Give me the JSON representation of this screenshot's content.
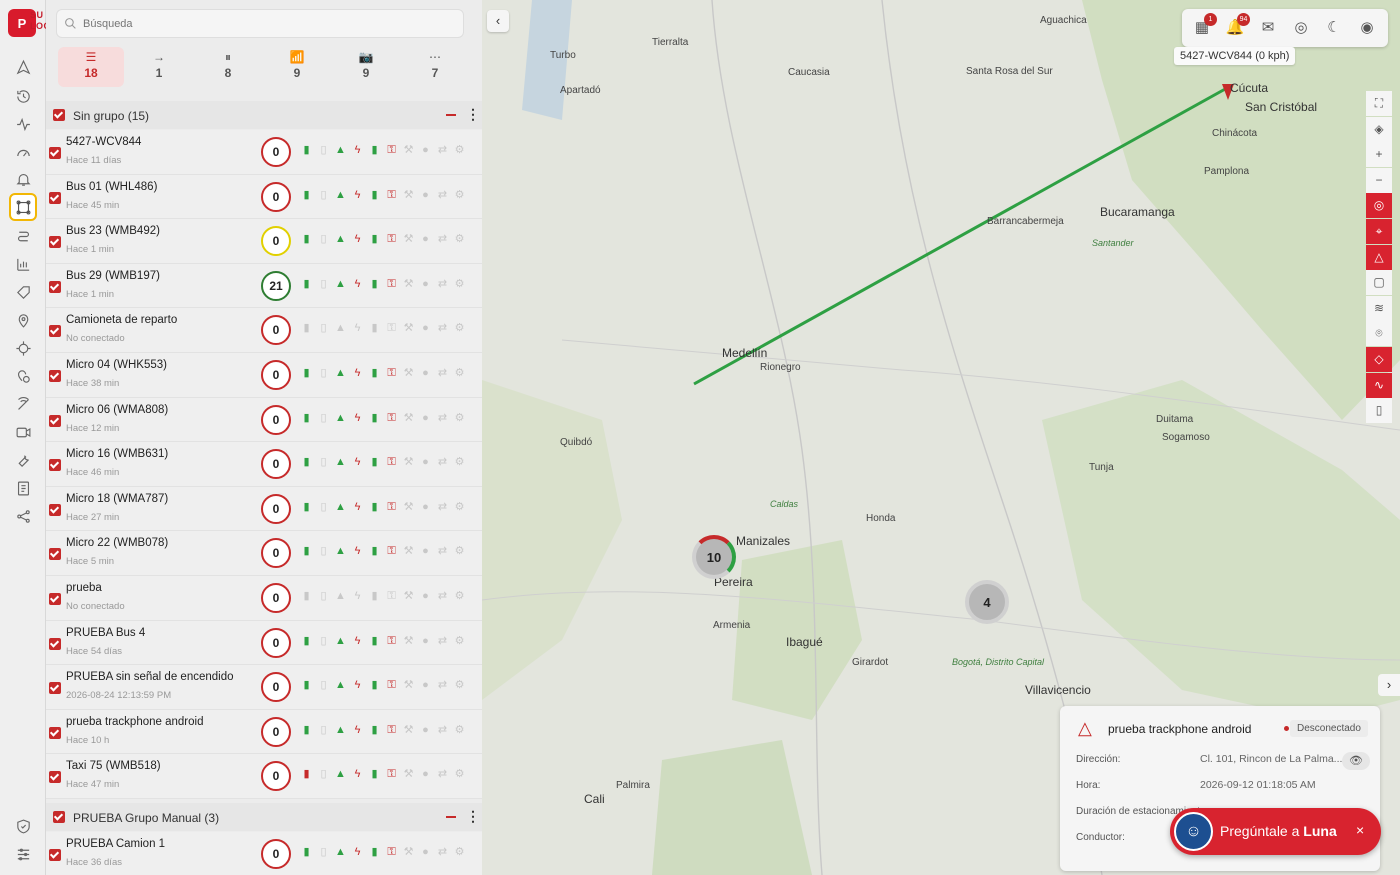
{
  "app": {
    "logo_letter": "P",
    "logo_sub": "SU\nLOGO"
  },
  "search": {
    "placeholder": "Búsqueda"
  },
  "filters": [
    {
      "icon": "list-icon",
      "glyph": "☰",
      "count": "18"
    },
    {
      "icon": "arrow-right-icon",
      "glyph": "→",
      "count": "1"
    },
    {
      "icon": "pause-icon",
      "glyph": "⏸",
      "count": "8"
    },
    {
      "icon": "no-signal-icon",
      "glyph": "📶",
      "count": "9"
    },
    {
      "icon": "camera-icon",
      "glyph": "📷",
      "count": "9"
    },
    {
      "icon": "more-icon",
      "glyph": "⋯",
      "count": "7"
    }
  ],
  "groups": [
    {
      "title": "Sin grupo (15)"
    },
    {
      "title": "PRUEBA Grupo Manual (3)"
    }
  ],
  "vehicles": [
    {
      "name": "5427-WCV844",
      "sub": "Hace 11 días",
      "speed": "0",
      "ring": "red"
    },
    {
      "name": "Bus 01 (WHL486)",
      "sub": "Hace 45 min",
      "speed": "0",
      "ring": "red"
    },
    {
      "name": "Bus 23 (WMB492)",
      "sub": "Hace 1 min",
      "speed": "0",
      "ring": "yellow"
    },
    {
      "name": "Bus 29 (WMB197)",
      "sub": "Hace 1 min",
      "speed": "21",
      "ring": "green"
    },
    {
      "name": "Camioneta de reparto",
      "sub": "No conectado",
      "speed": "0",
      "ring": "red"
    },
    {
      "name": "Micro 04 (WHK553)",
      "sub": "Hace 38 min",
      "speed": "0",
      "ring": "red"
    },
    {
      "name": "Micro 06 (WMA808)",
      "sub": "Hace 12 min",
      "speed": "0",
      "ring": "red"
    },
    {
      "name": "Micro 16 (WMB631)",
      "sub": "Hace 46 min",
      "speed": "0",
      "ring": "red"
    },
    {
      "name": "Micro 18 (WMA787)",
      "sub": "Hace 27 min",
      "speed": "0",
      "ring": "red"
    },
    {
      "name": "Micro 22 (WMB078)",
      "sub": "Hace 5 min",
      "speed": "0",
      "ring": "red"
    },
    {
      "name": "prueba",
      "sub": "No conectado",
      "speed": "0",
      "ring": "red"
    },
    {
      "name": "PRUEBA Bus 4",
      "sub": "Hace 54 días",
      "speed": "0",
      "ring": "red"
    },
    {
      "name": "PRUEBA sin señal de encendido",
      "sub": "2026-08-24 12:13:59 PM",
      "speed": "0",
      "ring": "red"
    },
    {
      "name": "prueba trackphone android",
      "sub": "Hace 10 h",
      "speed": "0",
      "ring": "red"
    },
    {
      "name": "Taxi 75 (WMB518)",
      "sub": "Hace 47 min",
      "speed": "0",
      "ring": "red"
    },
    {
      "name": "PRUEBA Camion 1",
      "sub": "Hace 36 días",
      "speed": "0",
      "ring": "red"
    }
  ],
  "map": {
    "tooltip": "5427-WCV844 (0 kph)",
    "badges": {
      "notifications": "1",
      "alerts": "94"
    },
    "clusters": [
      {
        "count": "10"
      },
      {
        "count": "4"
      }
    ],
    "cities": [
      "Turbo",
      "Tierralta",
      "Caucasia",
      "Apartadó",
      "Santa Rosa del Sur",
      "Aguachica",
      "Cúcuta",
      "San Cristóbal",
      "Barrancabermeja",
      "Bucaramanga",
      "Pamplona",
      "Medellín",
      "Rionegro",
      "Quibdó",
      "Manizales",
      "Pereira",
      "Armenia",
      "Ibagué",
      "Honda",
      "Villavicencio",
      "Cali",
      "Tunja",
      "Sogamoso",
      "Duitama",
      "Bogotá, Distrito Capital",
      "Girardot",
      "Palmira",
      "Chinácota",
      "Santander",
      "Caldas"
    ]
  },
  "info_card": {
    "title": "prueba trackphone android",
    "status": "Desconectado",
    "labels": [
      "Dirección:",
      "Hora:",
      "Duración de estacionamiento:",
      "Conductor:"
    ],
    "address": "Cl. 101, Rincon de La Palma...",
    "time": "2026-09-12 01:18:05 AM"
  },
  "assistant": {
    "label": "Pregúntale a ",
    "name": "Luna"
  }
}
